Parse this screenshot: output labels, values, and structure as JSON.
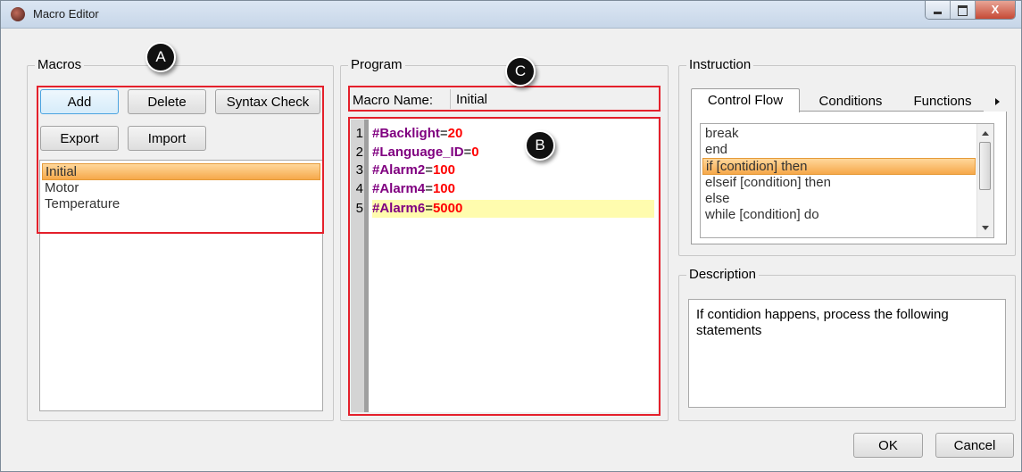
{
  "window": {
    "title": "Macro Editor",
    "close_label": "X"
  },
  "macros": {
    "group_title": "Macros",
    "add_label": "Add",
    "delete_label": "Delete",
    "syntax_check_label": "Syntax Check",
    "export_label": "Export",
    "import_label": "Import",
    "items": [
      "Initial",
      "Motor",
      "Temperature"
    ],
    "selected": "Initial"
  },
  "program": {
    "group_title": "Program",
    "macro_name_label": "Macro Name:",
    "macro_name_value": "Initial",
    "lines": [
      {
        "num": "1",
        "var": "#Backlight",
        "op": "=",
        "val": "20"
      },
      {
        "num": "2",
        "var": "#Language_ID",
        "op": "=",
        "val": "0"
      },
      {
        "num": "3",
        "var": "#Alarm2",
        "op": "=",
        "val": "100"
      },
      {
        "num": "4",
        "var": "#Alarm4",
        "op": "=",
        "val": "100"
      },
      {
        "num": "5",
        "var": "#Alarm6",
        "op": "=",
        "val": "5000"
      }
    ]
  },
  "instruction": {
    "group_title": "Instruction",
    "tabs": [
      "Control Flow",
      "Conditions",
      "Functions"
    ],
    "active_tab": "Control Flow",
    "items": [
      "break",
      "end",
      "if [contidion] then",
      "elseif [condition] then",
      "else",
      "while [condition] do"
    ],
    "selected": "if [contidion] then"
  },
  "description": {
    "group_title": "Description",
    "text": "If contidion happens, process the following statements"
  },
  "footer": {
    "ok_label": "OK",
    "cancel_label": "Cancel"
  },
  "annotations": {
    "a": "A",
    "b": "B",
    "c": "C"
  },
  "colors": {
    "annotation_box": "#e4202b",
    "variable": "#800080",
    "value": "#ff0000",
    "selection": "#f6a84a",
    "current_line": "#fffcae"
  }
}
